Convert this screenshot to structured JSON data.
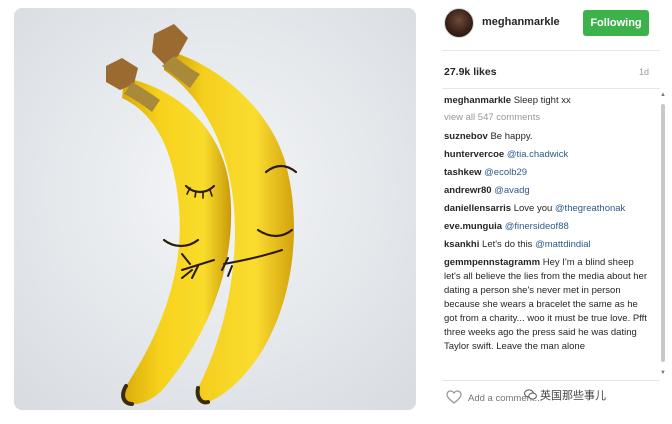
{
  "post": {
    "image_alt": "Two bananas with drawn faces hugging",
    "username": "meghanmarkle",
    "follow_label": "Following",
    "likes": "27.9k likes",
    "age": "1d",
    "caption": {
      "user": "meghanmarkle",
      "text": "Sleep tight xx"
    },
    "view_all": "view all 547 comments",
    "comments": [
      {
        "user": "suznebov",
        "text": "Be happy.",
        "mention": ""
      },
      {
        "user": "huntervercoe",
        "text": "",
        "mention": "@tia.chadwick"
      },
      {
        "user": "tashkew",
        "text": "",
        "mention": "@ecolb29"
      },
      {
        "user": "andrewr80",
        "text": "",
        "mention": "@avadg"
      },
      {
        "user": "daniellensarris",
        "text": "Love you",
        "mention": "@thegreathonak"
      },
      {
        "user": "eve.munguia",
        "text": "",
        "mention": "@finersideof88"
      },
      {
        "user": "ksankhi",
        "text": "Let's do this",
        "mention": "@mattdindial"
      },
      {
        "user": "gemmpennstagramm",
        "text": "Hey I'm a blind sheep let's all believe the lies from the media about her dating a person she's never met in person because she wears a bracelet the same as he got from a charity... woo it must be true love. Pfft three weeks ago the press said he was dating Taylor swift. Leave the man alone",
        "mention": ""
      }
    ],
    "add_comment_placeholder": "Add a comment...",
    "watermark": "英国那些事儿"
  },
  "colors": {
    "follow_button": "#3db24a",
    "mention": "#2d5a87",
    "muted": "#999999"
  },
  "icons": {
    "heart": "heart-icon",
    "watermark": "wechat-icon"
  }
}
